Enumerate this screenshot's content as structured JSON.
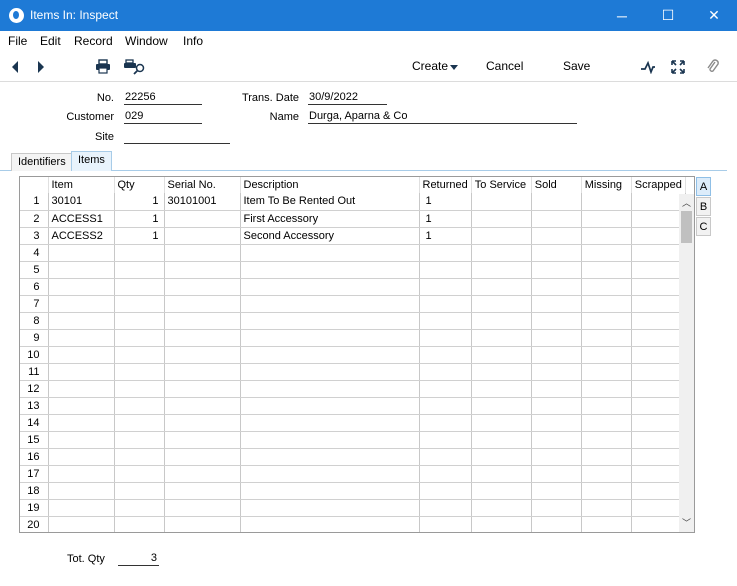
{
  "window": {
    "title": "Items In: Inspect",
    "min": "─",
    "max": "☐",
    "close": "✕"
  },
  "menu": [
    "File",
    "Edit",
    "Record",
    "Window",
    "Info"
  ],
  "toolbar": {
    "create_label": "Create",
    "cancel_label": "Cancel",
    "save_label": "Save"
  },
  "header": {
    "no_label": "No.",
    "no_value": "22256",
    "customer_label": "Customer",
    "customer_value": "029",
    "site_label": "Site",
    "site_value": "",
    "trans_date_label": "Trans. Date",
    "trans_date_value": "30/9/2022",
    "name_label": "Name",
    "name_value": "Durga, Aparna & Co"
  },
  "tabs": [
    "Identifiers",
    "Items"
  ],
  "grid": {
    "columns": [
      "Item",
      "Qty",
      "Serial No.",
      "Description",
      "Returned",
      "To Service",
      "Sold",
      "Missing",
      "Scrapped"
    ],
    "rows": [
      [
        "1",
        "30101",
        "1",
        "30101001",
        "Item To Be Rented Out",
        "1",
        "",
        "",
        "",
        ""
      ],
      [
        "2",
        "ACCESS1",
        "1",
        "",
        "First Accessory",
        "1",
        "",
        "",
        "",
        ""
      ],
      [
        "3",
        "ACCESS2",
        "1",
        "",
        "Second Accessory",
        "1",
        "",
        "",
        "",
        ""
      ],
      [
        "4",
        "",
        "",
        "",
        "",
        "",
        "",
        "",
        "",
        ""
      ],
      [
        "5",
        "",
        "",
        "",
        "",
        "",
        "",
        "",
        "",
        ""
      ],
      [
        "6",
        "",
        "",
        "",
        "",
        "",
        "",
        "",
        "",
        ""
      ],
      [
        "7",
        "",
        "",
        "",
        "",
        "",
        "",
        "",
        "",
        ""
      ],
      [
        "8",
        "",
        "",
        "",
        "",
        "",
        "",
        "",
        "",
        ""
      ],
      [
        "9",
        "",
        "",
        "",
        "",
        "",
        "",
        "",
        "",
        ""
      ],
      [
        "10",
        "",
        "",
        "",
        "",
        "",
        "",
        "",
        "",
        ""
      ],
      [
        "11",
        "",
        "",
        "",
        "",
        "",
        "",
        "",
        "",
        ""
      ],
      [
        "12",
        "",
        "",
        "",
        "",
        "",
        "",
        "",
        "",
        ""
      ],
      [
        "13",
        "",
        "",
        "",
        "",
        "",
        "",
        "",
        "",
        ""
      ],
      [
        "14",
        "",
        "",
        "",
        "",
        "",
        "",
        "",
        "",
        ""
      ],
      [
        "15",
        "",
        "",
        "",
        "",
        "",
        "",
        "",
        "",
        ""
      ],
      [
        "16",
        "",
        "",
        "",
        "",
        "",
        "",
        "",
        "",
        ""
      ],
      [
        "17",
        "",
        "",
        "",
        "",
        "",
        "",
        "",
        "",
        ""
      ],
      [
        "18",
        "",
        "",
        "",
        "",
        "",
        "",
        "",
        "",
        ""
      ],
      [
        "19",
        "",
        "",
        "",
        "",
        "",
        "",
        "",
        "",
        ""
      ],
      [
        "20",
        "",
        "",
        "",
        "",
        "",
        "",
        "",
        "",
        ""
      ]
    ]
  },
  "side_tabs": [
    "A",
    "B",
    "C"
  ],
  "footer": {
    "tot_qty_label": "Tot. Qty",
    "tot_qty_value": "3"
  },
  "colors": {
    "titlebar": "#1e7ad6",
    "active_tab": "#e8f3fc"
  }
}
